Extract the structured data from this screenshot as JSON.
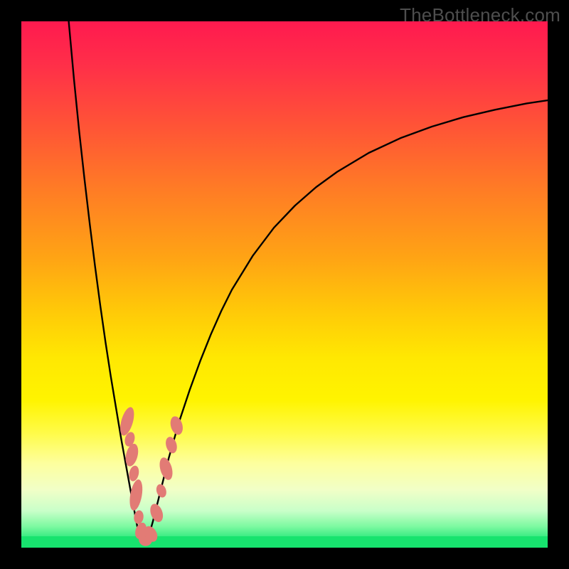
{
  "watermark": "TheBottleneck.com",
  "colors": {
    "curve": "#000000",
    "bead": "#e27b75",
    "beadStroke": "#b85650"
  },
  "chart_data": {
    "type": "line",
    "title": "",
    "xlabel": "",
    "ylabel": "",
    "xlim": [
      0,
      100
    ],
    "ylim": [
      0,
      100
    ],
    "series": [
      {
        "name": "left-branch",
        "x": [
          9,
          10,
          11,
          12,
          13,
          14,
          15,
          16,
          17,
          18,
          19,
          20,
          21,
          22
        ],
        "y": [
          100,
          89,
          79,
          70,
          61.5,
          53.5,
          46,
          39,
          32.5,
          26.5,
          20.5,
          15,
          9.5,
          4.2
        ]
      },
      {
        "name": "right-branch",
        "x": [
          24,
          25,
          26,
          27,
          28,
          29,
          30,
          32,
          34,
          36,
          38,
          40,
          44,
          48,
          52,
          56,
          60,
          66,
          72,
          78,
          84,
          90,
          96,
          100
        ],
        "y": [
          1.5,
          5,
          9,
          13,
          17,
          20.5,
          24,
          30,
          35.5,
          40.5,
          45,
          49,
          55.5,
          60.8,
          65,
          68.5,
          71.4,
          75,
          77.8,
          80,
          81.8,
          83.2,
          84.4,
          85
        ]
      },
      {
        "name": "valley-floor",
        "x": [
          22,
          22.5,
          23,
          23.5,
          24
        ],
        "y": [
          4.2,
          2.2,
          1.2,
          1.2,
          1.5
        ]
      }
    ],
    "beads": [
      {
        "cx": 20.1,
        "cy": 24.0,
        "rx": 1.1,
        "ry": 2.8,
        "rot": 16
      },
      {
        "cx": 20.6,
        "cy": 20.6,
        "rx": 0.9,
        "ry": 1.4,
        "rot": 16
      },
      {
        "cx": 21.0,
        "cy": 17.6,
        "rx": 1.1,
        "ry": 2.2,
        "rot": 14
      },
      {
        "cx": 21.4,
        "cy": 14.1,
        "rx": 0.9,
        "ry": 1.5,
        "rot": 12
      },
      {
        "cx": 21.8,
        "cy": 10.0,
        "rx": 1.1,
        "ry": 3.0,
        "rot": 10
      },
      {
        "cx": 22.3,
        "cy": 5.8,
        "rx": 0.9,
        "ry": 1.3,
        "rot": 8
      },
      {
        "cx": 22.7,
        "cy": 3.2,
        "rx": 1.0,
        "ry": 1.6,
        "rot": 18
      },
      {
        "cx": 23.6,
        "cy": 1.6,
        "rx": 1.3,
        "ry": 1.3,
        "rot": 0
      },
      {
        "cx": 24.6,
        "cy": 2.6,
        "rx": 1.1,
        "ry": 1.6,
        "rot": -30
      },
      {
        "cx": 25.7,
        "cy": 6.6,
        "rx": 1.1,
        "ry": 1.8,
        "rot": -20
      },
      {
        "cx": 26.6,
        "cy": 10.8,
        "rx": 0.9,
        "ry": 1.3,
        "rot": -18
      },
      {
        "cx": 27.5,
        "cy": 15.0,
        "rx": 1.1,
        "ry": 2.2,
        "rot": -16
      },
      {
        "cx": 28.5,
        "cy": 19.5,
        "rx": 1.0,
        "ry": 1.6,
        "rot": -16
      },
      {
        "cx": 29.5,
        "cy": 23.2,
        "rx": 1.1,
        "ry": 1.8,
        "rot": -16
      }
    ]
  }
}
